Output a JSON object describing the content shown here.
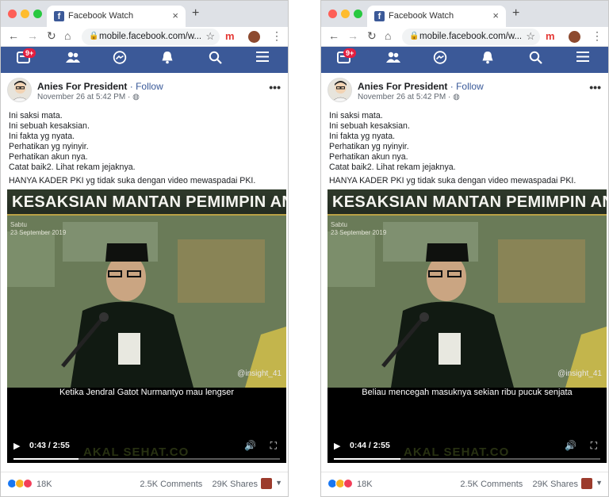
{
  "browser": {
    "tab_title": "Facebook Watch",
    "url": "mobile.facebook.com/w...",
    "new_tab": "+",
    "close_tab": "×",
    "ext_letter": "m"
  },
  "fbnav": {
    "notification_badge": "9+"
  },
  "post": {
    "author": "Anies For President",
    "follow": "Follow",
    "separator": "·",
    "timestamp": "November 26 at 5:42 PM",
    "more": "•••",
    "lines": [
      "Ini saksi mata.",
      "Ini sebuah kesaksian.",
      "Ini fakta yg nyata.",
      "Perhatikan yg nyinyir.",
      "Perhatikan akun nya.",
      "Catat baik2. Lihat rekam jejaknya."
    ],
    "headline": "HANYA KADER PKI yg tidak suka dengan video mewaspadai PKI."
  },
  "video_common": {
    "banner": "KESAKSIAN MANTAN PEMIMPIN ANSOR",
    "day": "Sabtu",
    "date": "23 September 2019",
    "watermark": "@insight_41",
    "brand": "AKAL SEHAT.CO"
  },
  "left": {
    "subtitle": "Ketika Jendral Gatot Nurmantyo mau lengser",
    "time": "0:43 / 2:55",
    "progress": 0.245
  },
  "right": {
    "subtitle": "Beliau mencegah masuknya sekian ribu pucuk senjata",
    "time": "0:44 / 2:55",
    "progress": 0.251
  },
  "footer": {
    "reactions": "18K",
    "comments": "2.5K Comments",
    "shares": "29K Shares"
  },
  "colors": {
    "fb_blue": "#3b5998",
    "link": "#385898",
    "banner_gold": "#b9a145"
  },
  "icons": {
    "back": "arrow-left-icon",
    "forward": "arrow-right-icon",
    "reload": "reload-icon",
    "home": "home-icon",
    "lock": "lock-icon",
    "star": "star-icon",
    "home_feed": "feed-icon",
    "friends": "friends-icon",
    "messenger": "messenger-icon",
    "notifications": "bell-icon",
    "search": "search-icon",
    "menu": "menu-icon",
    "play": "play-icon",
    "volume": "volume-icon",
    "fullscreen": "fullscreen-icon"
  }
}
